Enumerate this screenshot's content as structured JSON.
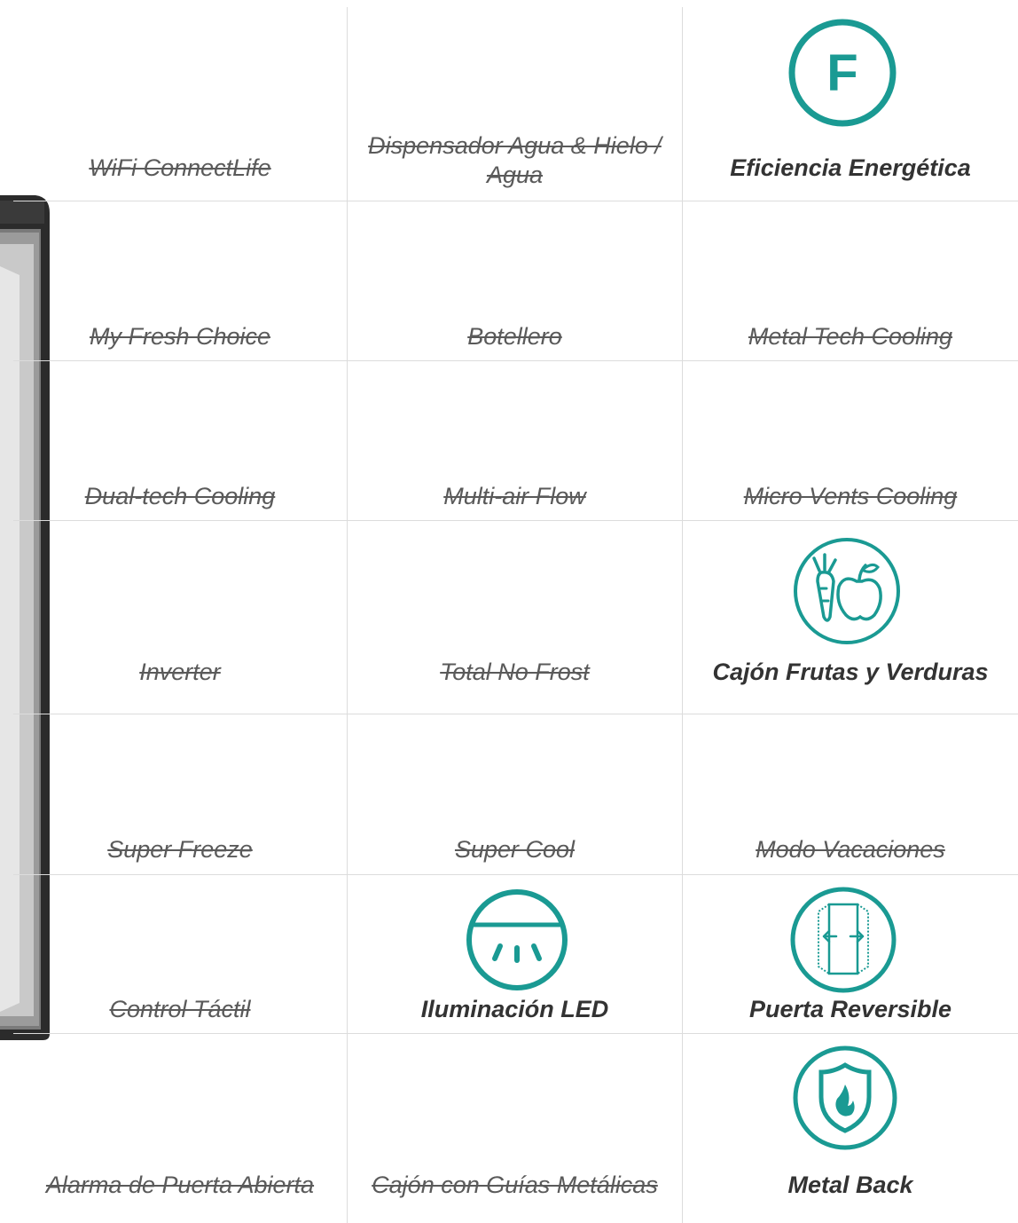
{
  "features": [
    {
      "label": "WiFi ConnectLife",
      "active": false
    },
    {
      "label": "Dispensador Agua & Hielo / Agua",
      "active": false
    },
    {
      "label": "Eficiencia Energética",
      "active": true,
      "icon": "energy-class-f-icon",
      "icon_text": "F"
    },
    {
      "label": "My Fresh Choice",
      "active": false
    },
    {
      "label": "Botellero",
      "active": false
    },
    {
      "label": "Metal Tech Cooling",
      "active": false
    },
    {
      "label": "Dual-tech Cooling",
      "active": false
    },
    {
      "label": "Multi-air Flow",
      "active": false
    },
    {
      "label": "Micro Vents Cooling",
      "active": false
    },
    {
      "label": "Inverter",
      "active": false
    },
    {
      "label": "Total No Frost",
      "active": false
    },
    {
      "label": "Cajón Frutas y Verduras",
      "active": true,
      "icon": "fruit-vegetable-icon"
    },
    {
      "label": "Super Freeze",
      "active": false
    },
    {
      "label": "Super Cool",
      "active": false
    },
    {
      "label": "Modo Vacaciones",
      "active": false
    },
    {
      "label": "Control Táctil",
      "active": false
    },
    {
      "label": "Iluminación LED",
      "active": true,
      "icon": "led-light-icon"
    },
    {
      "label": "Puerta Reversible",
      "active": true,
      "icon": "reversible-door-icon"
    },
    {
      "label": "Alarma de Puerta Abierta",
      "active": false
    },
    {
      "label": "Cajón con Guías Metálicas",
      "active": false
    },
    {
      "label": "Metal Back",
      "active": true,
      "icon": "metal-back-shield-icon"
    }
  ],
  "colors": {
    "accent": "#1a9a93",
    "text": "#444444",
    "grid": "#dcdcdc"
  }
}
